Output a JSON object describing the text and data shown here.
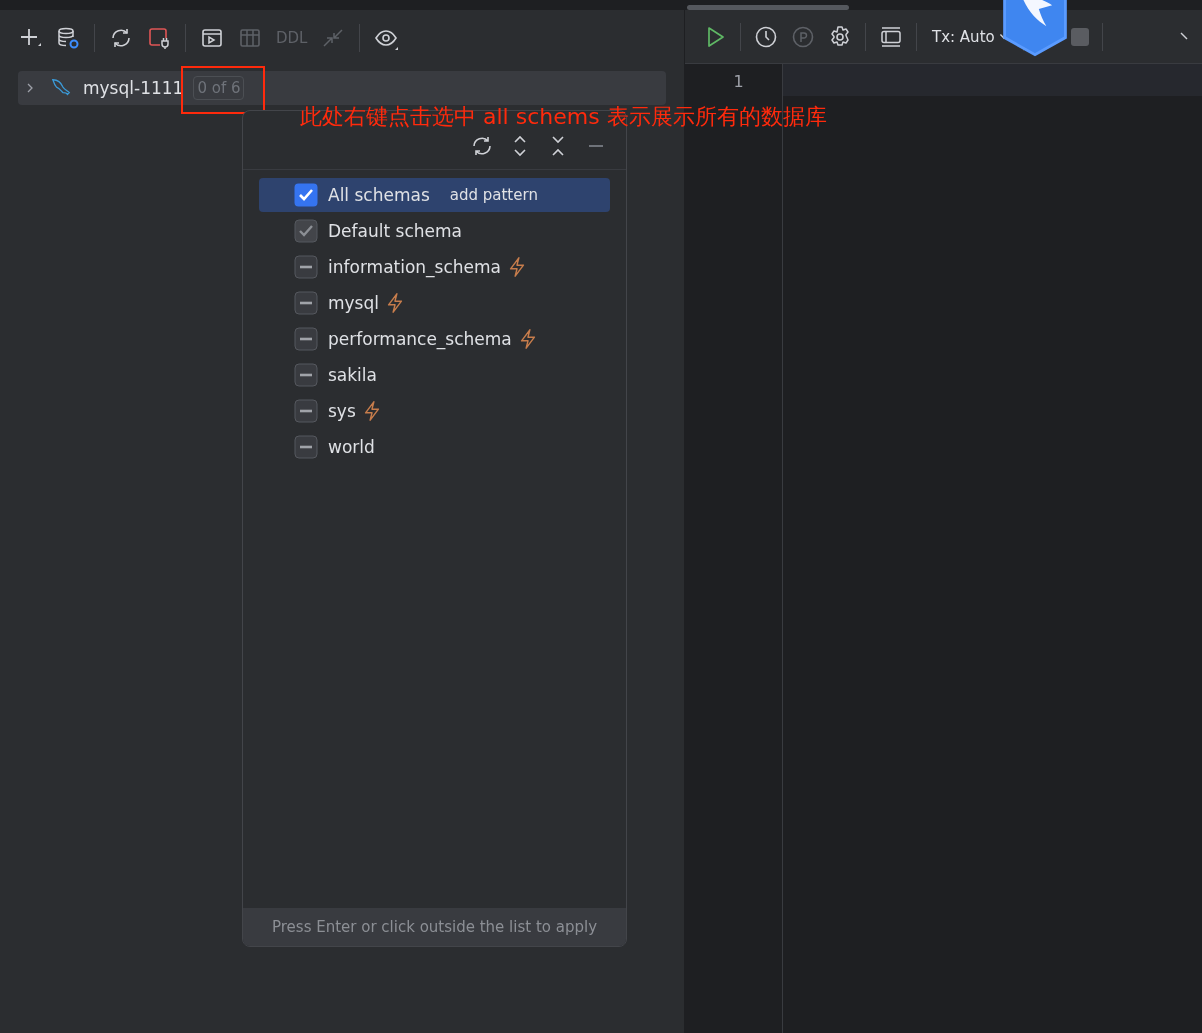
{
  "left_toolbar": {
    "tools": [
      {
        "kind": "add",
        "disabled": false
      },
      {
        "kind": "datasource",
        "disabled": false
      },
      {
        "kind": "sep"
      },
      {
        "kind": "refresh",
        "disabled": false
      },
      {
        "kind": "disconnect",
        "disabled": false
      },
      {
        "kind": "sep"
      },
      {
        "kind": "console",
        "disabled": false
      },
      {
        "kind": "table",
        "disabled": true
      },
      {
        "kind": "ddl",
        "label": "DDL",
        "disabled": true
      },
      {
        "kind": "jump",
        "disabled": true
      },
      {
        "kind": "sep"
      },
      {
        "kind": "view",
        "disabled": false
      }
    ]
  },
  "tree": {
    "connection": {
      "name": "mysql-1111",
      "expanded": false,
      "schema_count": "0 of 6"
    }
  },
  "annotation": {
    "text": "此处右键点击选中 all schems 表示展示所有的数据库"
  },
  "schema_popup": {
    "items": [
      {
        "name": "All schemas",
        "checked": true,
        "disabled": false,
        "selected": true,
        "extra": "add pattern",
        "introspect": false
      },
      {
        "name": "Default schema",
        "checked": true,
        "disabled": true,
        "selected": false,
        "introspect": false
      },
      {
        "name": "information_schema",
        "checked": false,
        "disabled": false,
        "selected": false,
        "introspect": true
      },
      {
        "name": "mysql",
        "checked": false,
        "disabled": false,
        "selected": false,
        "introspect": true
      },
      {
        "name": "performance_schema",
        "checked": false,
        "disabled": false,
        "selected": false,
        "introspect": true
      },
      {
        "name": "sakila",
        "checked": false,
        "disabled": false,
        "selected": false,
        "introspect": false
      },
      {
        "name": "sys",
        "checked": false,
        "disabled": false,
        "selected": false,
        "introspect": true
      },
      {
        "name": "world",
        "checked": false,
        "disabled": false,
        "selected": false,
        "introspect": false
      }
    ],
    "hint": "Press Enter or click outside the list to apply"
  },
  "editor_toolbar": {
    "tx_mode": "Tx: Auto"
  },
  "editor": {
    "line_numbers": [
      "1"
    ]
  }
}
